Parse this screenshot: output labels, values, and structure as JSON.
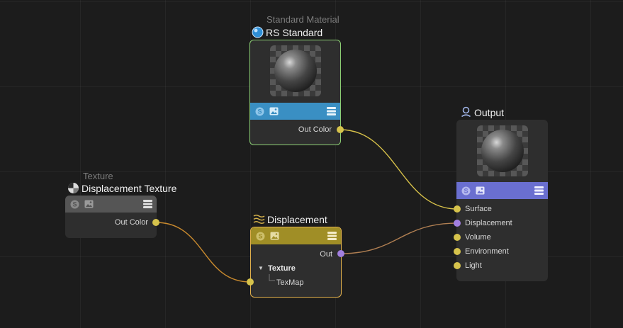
{
  "colors": {
    "canvas_bg": "#1c1c1c",
    "wire_yellow": "#d8c24a",
    "wire_orange": "#c98a2e",
    "wire_purple": "#b07f52",
    "port_yellow": "#d6c34c",
    "port_purple": "#a27fe0",
    "rs_bar": "#3a8fc3",
    "output_bar": "#6a6fd0",
    "displacement_bar": "#a08e26",
    "texture_bar": "#555555",
    "rs_border": "#8ccf74",
    "displacement_border": "#e1b04c"
  },
  "nodes": {
    "standard_material": {
      "type_label": "Standard Material",
      "title": "RS Standard",
      "icon": "sphere-icon",
      "outputs": [
        {
          "label": "Out Color",
          "port": "yellow"
        }
      ]
    },
    "output": {
      "title": "Output",
      "icon": "output-icon",
      "inputs": [
        {
          "label": "Surface",
          "port": "yellow"
        },
        {
          "label": "Displacement",
          "port": "purple"
        },
        {
          "label": "Volume",
          "port": "yellow"
        },
        {
          "label": "Environment",
          "port": "yellow"
        },
        {
          "label": "Light",
          "port": "yellow"
        }
      ]
    },
    "texture": {
      "type_label": "Texture",
      "title": "Displacement Texture",
      "icon": "texture-icon",
      "outputs": [
        {
          "label": "Out Color",
          "port": "yellow"
        }
      ]
    },
    "displacement": {
      "title": "Displacement",
      "icon": "displacement-icon",
      "outputs": [
        {
          "label": "Out",
          "port": "purple"
        }
      ],
      "group": {
        "label": "Texture",
        "expanded": true
      },
      "inputs": [
        {
          "label": "TexMap",
          "port": "yellow"
        }
      ]
    }
  },
  "bar_icons": [
    "redshift-icon",
    "image-icon",
    "menu-icon"
  ]
}
